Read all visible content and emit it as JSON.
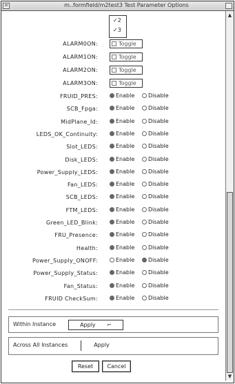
{
  "window": {
    "title": "m..formfield/m2test3 Test Parameter Options",
    "sys_icon": "="
  },
  "top_list": {
    "items": [
      "2",
      "3"
    ]
  },
  "alarm_rows": [
    {
      "label": "ALARM0ON:",
      "value": "Toggle"
    },
    {
      "label": "ALARM1ON:",
      "value": "Toggle"
    },
    {
      "label": "ALARM2ON:",
      "value": "Toggle"
    },
    {
      "label": "ALARM3ON:",
      "value": "Toggle"
    }
  ],
  "radio_labels": {
    "enable": "Enable",
    "disable": "Disable"
  },
  "radio_rows": [
    {
      "label": "FRUID_PRES:",
      "selected": "enable"
    },
    {
      "label": "SCB_Fpga:",
      "selected": "enable"
    },
    {
      "label": "MidPlane_Id:",
      "selected": "enable"
    },
    {
      "label": "LEDS_OK_Continuity:",
      "selected": "enable"
    },
    {
      "label": "Slot_LEDS:",
      "selected": "enable"
    },
    {
      "label": "Disk_LEDS:",
      "selected": "enable"
    },
    {
      "label": "Power_Supply_LEDS:",
      "selected": "enable"
    },
    {
      "label": "Fan_LEDS:",
      "selected": "enable"
    },
    {
      "label": "SCB_LEDS:",
      "selected": "enable"
    },
    {
      "label": "FTM_LEDS:",
      "selected": "enable"
    },
    {
      "label": "Green_LED_Blink:",
      "selected": "enable"
    },
    {
      "label": "FRU_Presence:",
      "selected": "enable"
    },
    {
      "label": "Health:",
      "selected": "enable"
    },
    {
      "label": "Power_Supply_ONOFF:",
      "selected": "disable"
    },
    {
      "label": "Power_Supply_Status:",
      "selected": "enable"
    },
    {
      "label": "Fan_Status:",
      "selected": "enable"
    },
    {
      "label": "FRUID CheckSum:",
      "selected": "enable"
    }
  ],
  "within_instance": {
    "label": "Within Instance",
    "button": "Apply"
  },
  "across_instances": {
    "label": "Across All Instances",
    "button": "Apply"
  },
  "footer": {
    "reset": "Reset",
    "cancel": "Cancel"
  }
}
